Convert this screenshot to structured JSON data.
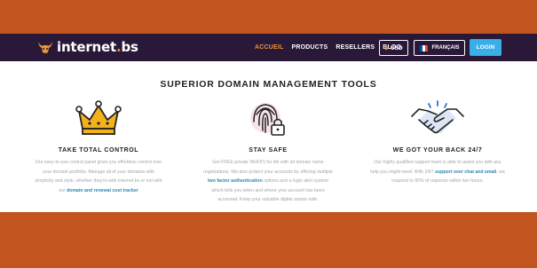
{
  "brand": {
    "name_prefix": "internet",
    "name_dot": ".",
    "name_suffix": "bs",
    "icon": "bull-logo-icon"
  },
  "nav": {
    "links": [
      "ACCUEIL",
      "PRODUCTS",
      "RESELLERS",
      "BLOG"
    ],
    "active_index": 0,
    "currency": {
      "symbol": "$",
      "code": "USD"
    },
    "language": {
      "label": "FRANÇAIS",
      "flag_colors": [
        "#0055a4",
        "#ffffff",
        "#ef4135"
      ]
    },
    "login_label": "LOGIN"
  },
  "colors": {
    "accent": "#e8963a",
    "nav_bg": "#2a1838",
    "page_bg": "#c2541f",
    "button": "#3aaee6",
    "link": "#2b86b8",
    "crown": "#f3b11c"
  },
  "main": {
    "headline": "SUPERIOR DOMAIN MANAGEMENT TOOLS",
    "features": [
      {
        "icon": "crown-icon",
        "title": "TAKE TOTAL CONTROL",
        "lines": [
          "Our easy-to-use control panel gives you effortless control over",
          "your domain portfolio. Manage all of your domains with",
          "simplicity and style, whether they're with internet.bs or not with"
        ],
        "last_pre": "our ",
        "last_link": "domain and renewal cost tracker"
      },
      {
        "icon": "fingerprint-lock-icon",
        "title": "STAY SAFE",
        "lines": [
          "Get FREE private WHOIS for life with all domain name",
          "registrations. We also protect your accounts by offering multiple"
        ],
        "link": "two factor authentication",
        "link_post": " options and a login alert system",
        "tail_lines": [
          "which tells you when and where your account has been",
          "accessed. Keep your valuable digital assets safe."
        ]
      },
      {
        "icon": "handshake-icon",
        "title": "WE GOT YOUR BACK 24/7",
        "lines": [
          "Our highly qualified support team is able to assist you with any"
        ],
        "pre_link": "help you might need. With 24/7 ",
        "link": "support over chat and email",
        "link_post": ", we",
        "tail_lines": [
          "respond to 95% of requests within two hours."
        ]
      }
    ]
  }
}
